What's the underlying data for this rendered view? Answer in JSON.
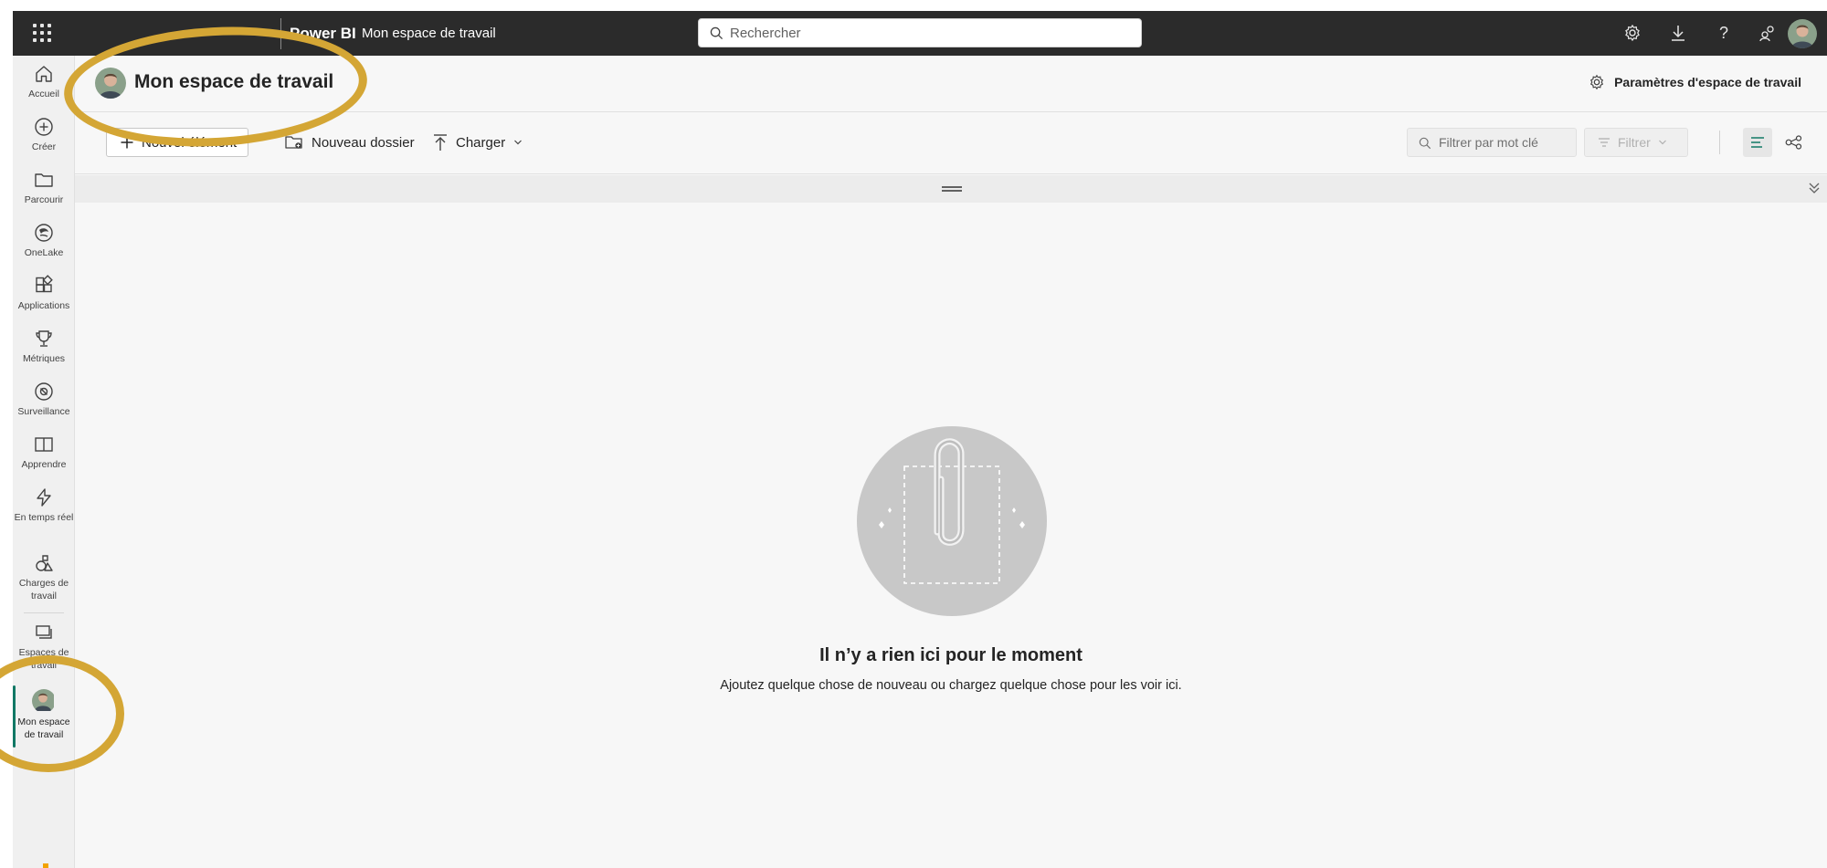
{
  "topbar": {
    "brand": "Power BI",
    "breadcrumb": "Mon espace de travail",
    "search_placeholder": "Rechercher",
    "icons": [
      "settings-icon",
      "download-icon",
      "help-icon",
      "share-icon"
    ]
  },
  "rail": {
    "items": [
      {
        "label": "Accueil",
        "icon": "home-icon"
      },
      {
        "label": "Créer",
        "icon": "plus-circle-icon"
      },
      {
        "label": "Parcourir",
        "icon": "folder-icon"
      },
      {
        "label": "OneLake",
        "icon": "onelake-icon"
      },
      {
        "label": "Applications",
        "icon": "apps-icon"
      },
      {
        "label": "Métriques",
        "icon": "trophy-icon"
      },
      {
        "label": "Surveillance",
        "icon": "monitor-icon"
      },
      {
        "label": "Apprendre",
        "icon": "book-icon"
      },
      {
        "label": "En temps réel",
        "icon": "lightning-icon"
      },
      {
        "label": "Charges de travail",
        "icon": "shapes-icon"
      },
      {
        "label": "Espaces de travail",
        "icon": "workspaces-icon"
      },
      {
        "label": "Mon espace de travail",
        "icon": "avatar"
      }
    ],
    "active_index": 11
  },
  "header": {
    "title": "Mon espace de travail",
    "settings_label": "Paramètres d'espace de travail"
  },
  "commands": {
    "new_item": "Nouvel élément",
    "new_folder": "Nouveau dossier",
    "upload": "Charger",
    "filter_placeholder": "Filtrer par mot clé",
    "filter_button": "Filtrer"
  },
  "empty_state": {
    "title": "Il n’y a rien ici pour le moment",
    "subtitle": "Ajoutez quelque chose de nouveau ou chargez quelque chose pour les voir ici."
  },
  "colors": {
    "topbar": "#2b2b2b",
    "accent": "#117865",
    "highlight": "#d4a635"
  }
}
